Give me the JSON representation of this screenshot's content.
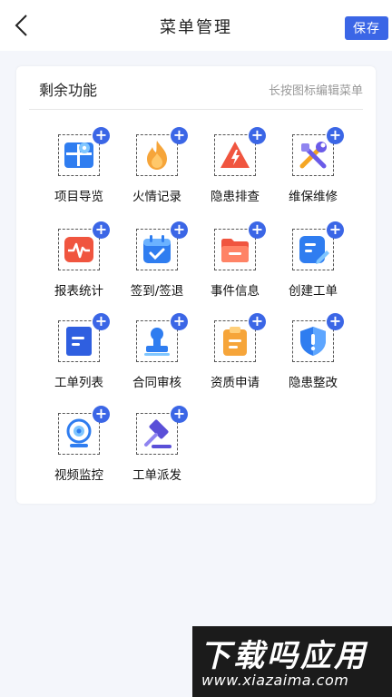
{
  "header": {
    "title": "菜单管理",
    "save_label": "保存"
  },
  "section": {
    "title": "剩余功能",
    "hint": "长按图标编辑菜单"
  },
  "items": [
    {
      "label": "项目导览",
      "icon": "map-grid-icon",
      "color": "#2f7df0"
    },
    {
      "label": "火情记录",
      "icon": "flame-icon",
      "color": "#f6a53a"
    },
    {
      "label": "隐患排查",
      "icon": "warning-triangle-icon",
      "color": "#f0553f"
    },
    {
      "label": "维保维修",
      "icon": "tools-icon",
      "color": "#6a5be8"
    },
    {
      "label": "报表统计",
      "icon": "chart-pulse-icon",
      "color": "#f0553f"
    },
    {
      "label": "签到/签退",
      "icon": "calendar-check-icon",
      "color": "#2f7df0"
    },
    {
      "label": "事件信息",
      "icon": "folder-icon",
      "color": "#f0553f"
    },
    {
      "label": "创建工单",
      "icon": "edit-document-icon",
      "color": "#2f7df0"
    },
    {
      "label": "工单列表",
      "icon": "document-list-icon",
      "color": "#2f5fe0"
    },
    {
      "label": "合同审核",
      "icon": "stamp-icon",
      "color": "#2f7df0"
    },
    {
      "label": "资质申请",
      "icon": "clipboard-icon",
      "color": "#f6a53a"
    },
    {
      "label": "隐患整改",
      "icon": "shield-alert-icon",
      "color": "#2f7df0"
    },
    {
      "label": "视频监控",
      "icon": "webcam-icon",
      "color": "#2f7df0"
    },
    {
      "label": "工单派发",
      "icon": "gavel-icon",
      "color": "#5a4fd8"
    }
  ],
  "plus_symbol": "+",
  "watermark": {
    "main": "下载吗应用",
    "sub": "www.xiazaima.com"
  }
}
